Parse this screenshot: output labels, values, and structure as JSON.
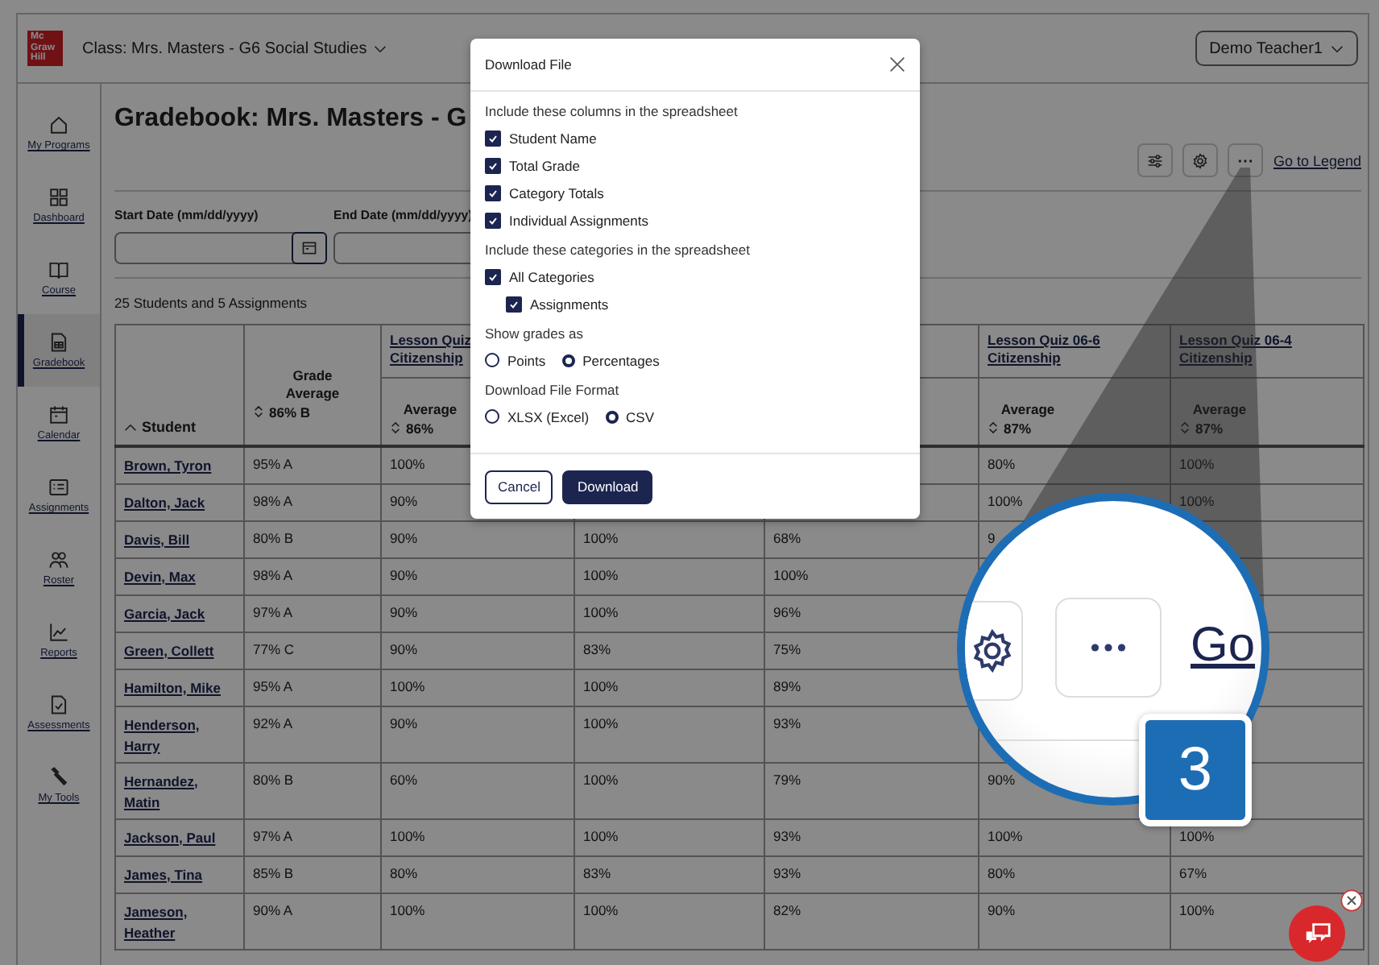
{
  "header": {
    "logo_lines": [
      "Mc",
      "Graw",
      "Hill"
    ],
    "class_label": "Class: Mrs. Masters - G6 Social Studies",
    "user_button": "Demo Teacher1"
  },
  "sidebar": {
    "items": [
      {
        "label": "My Programs",
        "selected": false
      },
      {
        "label": "Dashboard",
        "selected": false
      },
      {
        "label": "Course",
        "selected": false
      },
      {
        "label": "Gradebook",
        "selected": true
      },
      {
        "label": "Calendar",
        "selected": false
      },
      {
        "label": "Assignments",
        "selected": false
      },
      {
        "label": "Roster",
        "selected": false
      },
      {
        "label": "Reports",
        "selected": false
      },
      {
        "label": "Assessments",
        "selected": false
      },
      {
        "label": "My Tools",
        "selected": false
      }
    ]
  },
  "page_title": "Gradebook: Mrs. Masters - G",
  "toolbar": {
    "legend_link": "Go to Legend"
  },
  "filters": {
    "start_label": "Start Date (mm/dd/yyyy)",
    "end_label": "End Date (mm/dd/yyyy)"
  },
  "summary": "25 Students and 5 Assignments",
  "table": {
    "columns": [
      {
        "kind": "student",
        "label": "Student"
      },
      {
        "kind": "summary",
        "label": "Grade Average",
        "value": "86% B"
      },
      {
        "kind": "assignment",
        "title": "Lesson Quiz Citizenship",
        "label": "Average",
        "value": "86%"
      },
      {
        "kind": "covered"
      },
      {
        "kind": "covered"
      },
      {
        "kind": "assignment",
        "title": "Lesson Quiz 06-6 Citizenship",
        "label": "Average",
        "value": "87%"
      },
      {
        "kind": "assignment",
        "title": "Lesson Quiz 06-4 Citizenship",
        "label": "Average",
        "value": "87%"
      }
    ],
    "rows": [
      {
        "cells": [
          "Brown, Tyron",
          "95% A",
          "100%",
          null,
          null,
          "80%",
          "100%"
        ]
      },
      {
        "cells": [
          "Dalton, Jack",
          "98% A",
          "90%",
          null,
          null,
          "100%",
          "100%"
        ]
      },
      {
        "cells": [
          "Davis, Bill",
          "80% B",
          "90%",
          "100%",
          "68%",
          "9",
          null
        ]
      },
      {
        "cells": [
          "Devin, Max",
          "98% A",
          "90%",
          "100%",
          "100%",
          null,
          null
        ]
      },
      {
        "cells": [
          "Garcia, Jack",
          "97% A",
          "90%",
          "100%",
          "96%",
          null,
          null
        ]
      },
      {
        "cells": [
          "Green, Collett",
          "77% C",
          "90%",
          "83%",
          "75%",
          null,
          null
        ]
      },
      {
        "cells": [
          "Hamilton, Mike",
          "95% A",
          "100%",
          "100%",
          "89%",
          null,
          null
        ]
      },
      {
        "cells": [
          "Henderson, Harry",
          "92% A",
          "90%",
          "100%",
          "93%",
          null,
          null
        ]
      },
      {
        "cells": [
          "Hernandez, Matin",
          "80% B",
          "60%",
          "100%",
          "79%",
          "90%",
          null
        ]
      },
      {
        "cells": [
          "Jackson, Paul",
          "97% A",
          "100%",
          "100%",
          "93%",
          "100%",
          "100%"
        ]
      },
      {
        "cells": [
          "James, Tina",
          "85% B",
          "80%",
          "83%",
          "93%",
          "80%",
          "67%"
        ]
      },
      {
        "cells": [
          "Jameson, Heather",
          "90% A",
          "100%",
          "100%",
          "82%",
          "90%",
          "100%"
        ]
      }
    ]
  },
  "dialog": {
    "title": "Download File",
    "sections": [
      {
        "kind": "checkboxes",
        "label": "Include these columns in the spreadsheet",
        "options": [
          {
            "label": "Student Name",
            "checked": true
          },
          {
            "label": "Total Grade",
            "checked": true
          },
          {
            "label": "Category Totals",
            "checked": true
          },
          {
            "label": "Individual Assignments",
            "checked": true
          }
        ]
      },
      {
        "kind": "checkboxes",
        "label": "Include these categories in the spreadsheet",
        "options": [
          {
            "label": "All Categories",
            "checked": true,
            "children": [
              {
                "label": "Assignments",
                "checked": true
              }
            ]
          }
        ]
      },
      {
        "kind": "radios",
        "label": "Show grades as",
        "options": [
          {
            "label": "Points",
            "selected": false
          },
          {
            "label": "Percentages",
            "selected": true
          }
        ]
      },
      {
        "kind": "radios",
        "label": "Download File Format",
        "options": [
          {
            "label": "XLSX (Excel)",
            "selected": false
          },
          {
            "label": "CSV",
            "selected": true
          }
        ]
      }
    ],
    "buttons": [
      {
        "label": "Cancel",
        "kind": "secondary"
      },
      {
        "label": "Download",
        "kind": "primary"
      }
    ]
  },
  "callout": {
    "link_text": "Go",
    "badge": "3"
  }
}
